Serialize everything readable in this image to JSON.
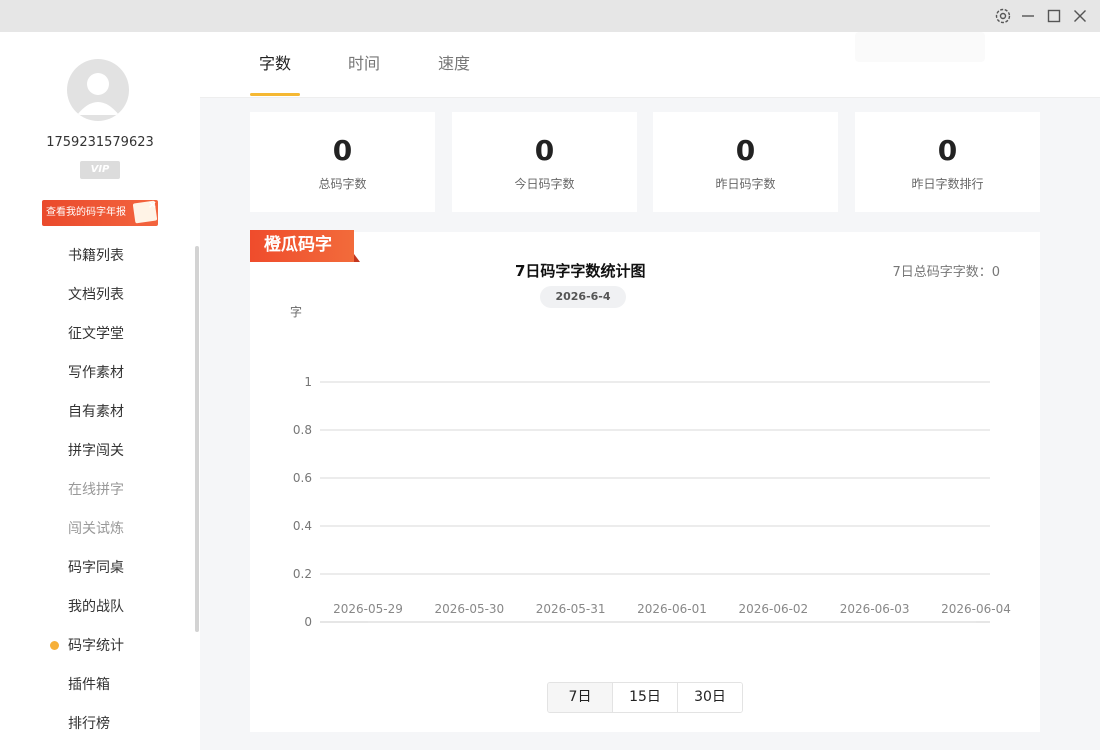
{
  "window": {
    "controls": [
      "settings-icon",
      "minimize-icon",
      "maximize-icon",
      "close-icon"
    ]
  },
  "user": {
    "id": "1759231579623",
    "vip_label": "VIP",
    "report_banner": "查看我的码字年报"
  },
  "nav": {
    "items": [
      {
        "label": "书籍列表",
        "state": "normal"
      },
      {
        "label": "文档列表",
        "state": "normal"
      },
      {
        "label": "征文学堂",
        "state": "normal"
      },
      {
        "label": "写作素材",
        "state": "normal"
      },
      {
        "label": "自有素材",
        "state": "normal"
      },
      {
        "label": "拼字闯关",
        "state": "normal"
      },
      {
        "label": "在线拼字",
        "state": "disabled"
      },
      {
        "label": "闯关试炼",
        "state": "disabled"
      },
      {
        "label": "码字同桌",
        "state": "normal"
      },
      {
        "label": "我的战队",
        "state": "normal"
      },
      {
        "label": "码字统计",
        "state": "active"
      },
      {
        "label": "插件箱",
        "state": "normal"
      },
      {
        "label": "排行榜",
        "state": "normal"
      }
    ]
  },
  "tabs": [
    {
      "label": "字数",
      "active": true
    },
    {
      "label": "时间",
      "active": false
    },
    {
      "label": "速度",
      "active": false
    }
  ],
  "stats": [
    {
      "value": "0",
      "label": "总码字数"
    },
    {
      "value": "0",
      "label": "今日码字数"
    },
    {
      "value": "0",
      "label": "昨日码字数"
    },
    {
      "value": "0",
      "label": "昨日字数排行"
    }
  ],
  "chart_panel": {
    "brand": "橙瓜码字",
    "date_pill": "2026-6-4",
    "total_text": "7日总码字字数：0",
    "range_buttons": [
      {
        "label": "7日",
        "active": true
      },
      {
        "label": "15日",
        "active": false
      },
      {
        "label": "30日",
        "active": false
      }
    ]
  },
  "colors": {
    "accent": "#f5b833",
    "brand": "#ef4c2c",
    "active_dot": "#f6b03a"
  },
  "chart_data": {
    "type": "line",
    "title": "7日码字字数统计图",
    "ylabel": "字",
    "xlabel": "",
    "ylim": [
      0,
      1
    ],
    "yticks": [
      0,
      0.2,
      0.4,
      0.6,
      0.8,
      1
    ],
    "categories": [
      "2026-05-29",
      "2026-05-30",
      "2026-05-31",
      "2026-06-01",
      "2026-06-02",
      "2026-06-03",
      "2026-06-04"
    ],
    "series": [
      {
        "values": [
          0,
          0,
          0,
          0,
          0,
          0,
          0
        ]
      }
    ],
    "grid": true,
    "legend": "none"
  }
}
